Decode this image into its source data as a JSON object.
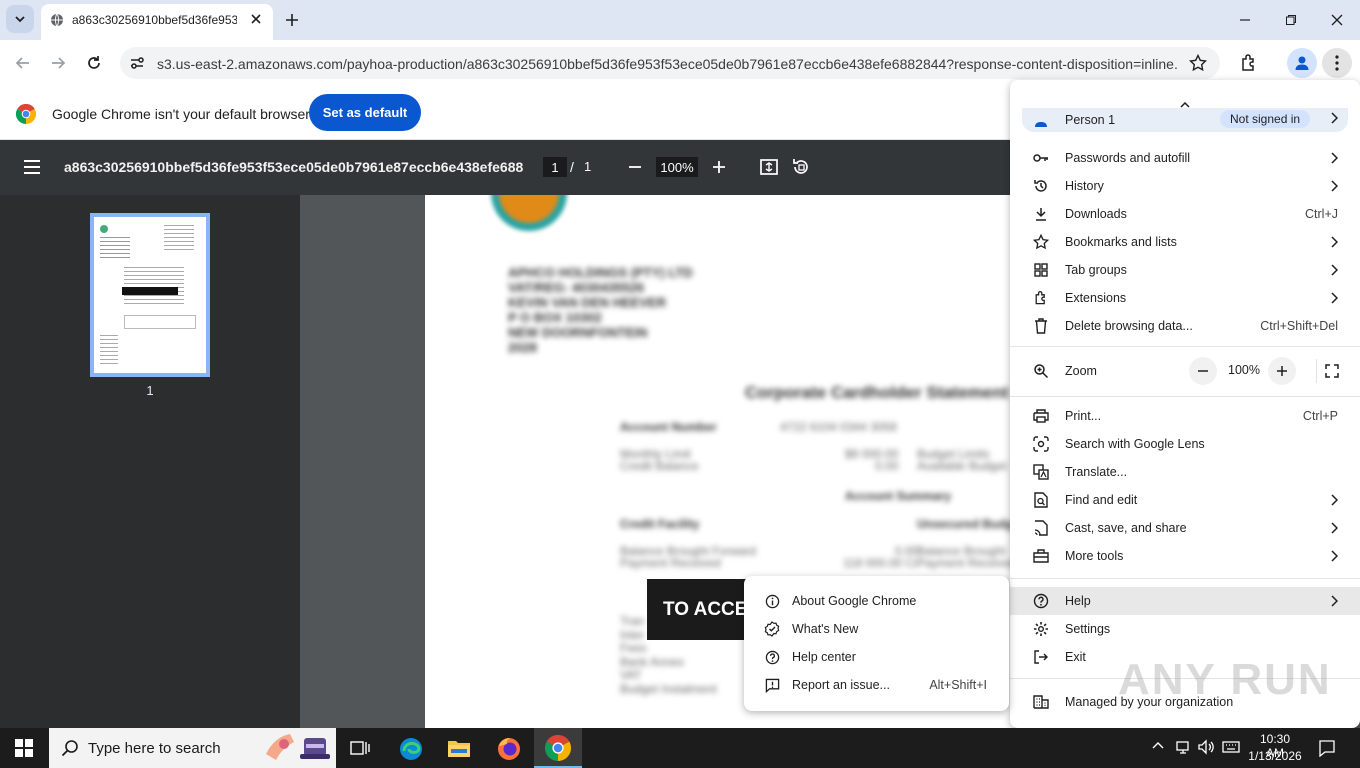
{
  "tab": {
    "title": "a863c30256910bbef5d36fe953f"
  },
  "toolbar": {
    "url": "s3.us-east-2.amazonaws.com/payhoa-production/a863c30256910bbef5d36fe953f53ece05de0b7961e87eccb6e438efe6882844?response-content-disposition=inline..."
  },
  "infobar": {
    "message": "Google Chrome isn't your default browser",
    "button": "Set as default"
  },
  "pdf": {
    "title": "a863c30256910bbef5d36fe953f53ece05de0b7961e87eccb6e438efe688...",
    "page_current": "1",
    "page_separator": "/",
    "page_total": "1",
    "zoom": "100%",
    "thumb_label": "1",
    "banner": "TO ACCE",
    "doc": {
      "company_lines": [
        "APHCO HOLDINGS (PTY) LTD",
        "VAT/REG: 4030435526",
        "KEVIN VAN DEN HEEVER",
        "P O BOX 10302",
        "NEW DOORNFONTEIN",
        "2028"
      ],
      "heading": "Corporate Cardholder Statement",
      "account_number_label": "Account Number",
      "account_number": "4722 6104 0344 3058",
      "monthly_limit_label": "Monthly Limit",
      "credit_balance_label": "Credit Balance",
      "monthly_limit": "$9 000.00",
      "credit_balance": "0.00",
      "budget_limit_label": "Budget Limits",
      "available_budget_label": "Available Budget",
      "summary_heading": "Account Summary",
      "credit_facility": "Credit Facility",
      "unsecured": "Unsecured Budg",
      "balance_bf": "Balance Brought Forward",
      "payment_received": "Payment Received",
      "balance_bf_val": "0.00",
      "payment_received_val": "118 000.00 Cr",
      "balance_bf2": "Balance Brought",
      "payment_received2": "Payment Received",
      "sub_rows": [
        "Tran",
        "Inter",
        "Fees",
        "Bank Annex",
        "VAT",
        "Budget Instalment"
      ]
    }
  },
  "menu": {
    "profile": {
      "name": "Person 1",
      "status": "Not signed in"
    },
    "items": [
      {
        "label": "Passwords and autofill",
        "icon": "key-icon",
        "arrow": true
      },
      {
        "label": "History",
        "icon": "history-icon",
        "arrow": true
      },
      {
        "label": "Downloads",
        "icon": "download-icon",
        "shortcut": "Ctrl+J"
      },
      {
        "label": "Bookmarks and lists",
        "icon": "star-icon",
        "arrow": true
      },
      {
        "label": "Tab groups",
        "icon": "tab-groups-icon",
        "arrow": true
      },
      {
        "label": "Extensions",
        "icon": "puzzle-icon",
        "arrow": true
      },
      {
        "label": "Delete browsing data...",
        "icon": "trash-icon",
        "shortcut": "Ctrl+Shift+Del"
      }
    ],
    "zoom": {
      "label": "Zoom",
      "value": "100%"
    },
    "items2": [
      {
        "label": "Print...",
        "icon": "print-icon",
        "shortcut": "Ctrl+P"
      },
      {
        "label": "Search with Google Lens",
        "icon": "lens-icon"
      },
      {
        "label": "Translate...",
        "icon": "translate-icon"
      },
      {
        "label": "Find and edit",
        "icon": "find-icon",
        "arrow": true
      },
      {
        "label": "Cast, save, and share",
        "icon": "cast-icon",
        "arrow": true
      },
      {
        "label": "More tools",
        "icon": "toolbox-icon",
        "arrow": true
      }
    ],
    "items3": [
      {
        "label": "Help",
        "icon": "help-icon",
        "arrow": true
      },
      {
        "label": "Settings",
        "icon": "settings-icon"
      },
      {
        "label": "Exit",
        "icon": "exit-icon"
      }
    ],
    "managed": "Managed by your organization"
  },
  "help_submenu": {
    "items": [
      {
        "label": "About Google Chrome",
        "icon": "info-icon"
      },
      {
        "label": "What's New",
        "icon": "badge-check-icon"
      },
      {
        "label": "Help center",
        "icon": "help-icon"
      },
      {
        "label": "Report an issue...",
        "icon": "report-icon",
        "shortcut": "Alt+Shift+I"
      }
    ]
  },
  "taskbar": {
    "search_placeholder": "Type here to search",
    "time": "10:30 AM",
    "date": "1/13/2026"
  },
  "watermark": "ANY RUN",
  "colors": {
    "accent": "#0b57d0",
    "tabstrip": "#dfe6f3",
    "pdf_toolbar": "#323639",
    "pdf_background": "#525659",
    "thumb_highlight": "#8ab4f8",
    "taskbar": "#1c1c1c"
  }
}
